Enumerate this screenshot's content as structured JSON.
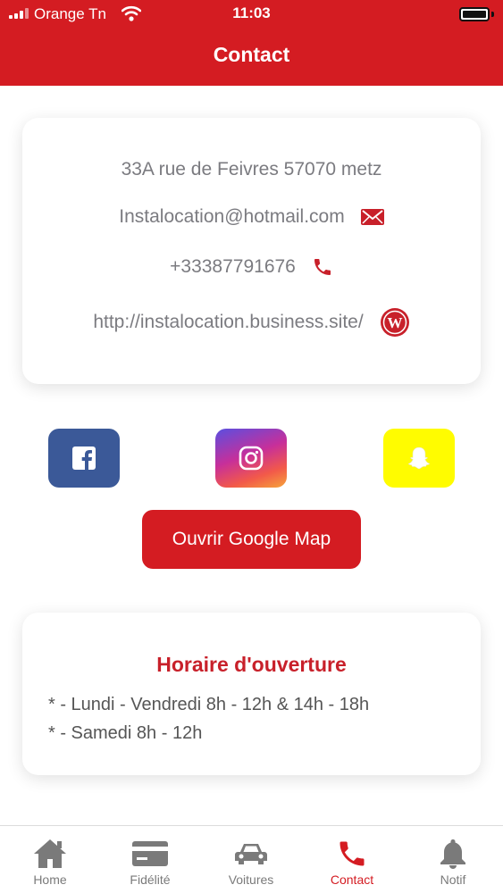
{
  "status_bar": {
    "carrier": "Orange Tn",
    "time": "11:03"
  },
  "header": {
    "title": "Contact"
  },
  "contact": {
    "address": "33A rue de Feivres 57070 metz",
    "email": "Instalocation@hotmail.com",
    "phone": "+33387791676",
    "website": "http://instalocation.business.site/"
  },
  "social": [
    {
      "name": "Facebook",
      "icon": "facebook-icon",
      "color": "#3b5998"
    },
    {
      "name": "Instagram",
      "icon": "instagram-icon"
    },
    {
      "name": "Snapchat",
      "icon": "snapchat-icon",
      "color": "#fffc00"
    }
  ],
  "map_button": {
    "label": "Ouvrir Google Map"
  },
  "hours": {
    "title": "Horaire d'ouverture",
    "lines": [
      "* - Lundi - Vendredi 8h - 12h & 14h - 18h",
      "* - Samedi 8h - 12h"
    ]
  },
  "tabs": [
    {
      "label": "Home",
      "icon": "home-icon",
      "active": false
    },
    {
      "label": "Fidélité",
      "icon": "card-icon",
      "active": false
    },
    {
      "label": "Voitures",
      "icon": "car-icon",
      "active": false
    },
    {
      "label": "Contact",
      "icon": "phone-icon",
      "active": true
    },
    {
      "label": "Notif",
      "icon": "bell-icon",
      "active": false
    }
  ],
  "colors": {
    "primary": "#d41c22",
    "inactive_tab": "#7a7a7a"
  }
}
